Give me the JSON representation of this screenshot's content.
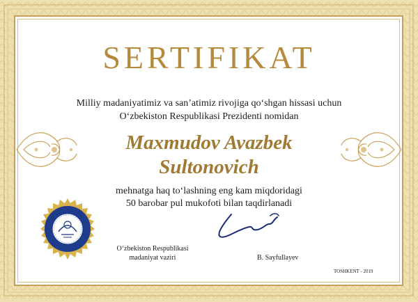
{
  "certificate": {
    "title": "SERTIFIKAT",
    "intro_line_1": "Milliy madaniyatimiz va san’atimiz rivojiga qo‘shgan hissasi uchun",
    "intro_line_2": "O‘zbekiston Respublikasi Prezidenti nomidan",
    "recipient_line_1": "Maxmudov Avazbek",
    "recipient_line_2": "Sultonovich",
    "award_line_1": "mehnatga haq to‘lashning eng kam miqdoridagi",
    "award_line_2": "50 barobar pul mukofoti bilan taqdirlanadi",
    "signer_title_line_1": "O‘zbekiston Respublikasi",
    "signer_title_line_2": "madaniyat vaziri",
    "signer_name": "B. Sayfullayev",
    "place_date": "TOSHKENT - 2019"
  },
  "colors": {
    "gold": "#b58a3c",
    "gold_dark": "#a07a32",
    "frame": "#efe0b0",
    "seal": "#1f3b8c",
    "seal_ring": "#d8b24a",
    "ink": "#1c1c1c"
  },
  "icons": {
    "emblem": "state-emblem-seal-icon",
    "signature": "signature-icon",
    "left_ornament": "floral-ornament-icon",
    "right_ornament": "floral-ornament-icon"
  }
}
